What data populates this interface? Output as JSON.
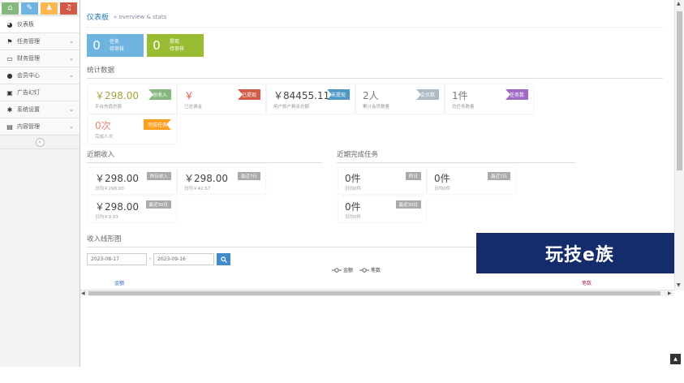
{
  "shortcuts": [
    {
      "icon": "home-icon",
      "glyph": "⌂",
      "color": "#87b87f"
    },
    {
      "icon": "pencil-icon",
      "glyph": "✎",
      "color": "#6fb3e0"
    },
    {
      "icon": "users-icon",
      "glyph": "♟",
      "color": "#ffb752"
    },
    {
      "icon": "bell-icon",
      "glyph": "♫",
      "color": "#d15b47"
    }
  ],
  "sidebar": {
    "items": [
      {
        "label": "仪表板",
        "icon": "dashboard-icon",
        "glyph": "◕",
        "chev": false
      },
      {
        "label": "任务管理",
        "icon": "flag-icon",
        "glyph": "⚑",
        "chev": true
      },
      {
        "label": "财务管理",
        "icon": "inbox-icon",
        "glyph": "▭",
        "chev": true
      },
      {
        "label": "会员中心",
        "icon": "user-icon",
        "glyph": "●",
        "chev": true
      },
      {
        "label": "广告幻灯",
        "icon": "picture-icon",
        "glyph": "▣",
        "chev": false
      },
      {
        "label": "系统设置",
        "icon": "gear-icon",
        "glyph": "✱",
        "chev": true
      },
      {
        "label": "内容管理",
        "icon": "book-icon",
        "glyph": "▤",
        "chev": true
      }
    ]
  },
  "header": {
    "title": "仪表板",
    "subtitle": "» overview & stats"
  },
  "tiles": [
    {
      "value": "0",
      "line1": "任务",
      "line2": "待审核",
      "color": "#6fb3e0"
    },
    {
      "value": "0",
      "line1": "提现",
      "line2": "待审核",
      "color": "#9abc32"
    }
  ],
  "stats_title": "统计数据",
  "stats": [
    {
      "value": "￥298.00",
      "caption": "平台充值总额",
      "badge": "总收入",
      "badge_color": "#87b87f",
      "value_color": "#a8a23d"
    },
    {
      "value": "￥",
      "caption": "已总佣金",
      "badge": "已提现",
      "badge_color": "#d15b47",
      "value_color": "#d15b47"
    },
    {
      "value": "￥84455.11",
      "caption": "用户账户剩余总额",
      "badge": "未提现",
      "badge_color": "#4f99c6",
      "value_color": "#444"
    },
    {
      "value": "2人",
      "caption": "累计会员数量",
      "badge": "会员数",
      "badge_color": "#abbac3",
      "value_color": "#777"
    },
    {
      "value": "1件",
      "caption": "总任务数量",
      "badge": "任务数",
      "badge_color": "#a069c3",
      "value_color": "#777"
    },
    {
      "value": "0次",
      "caption": "完成人次",
      "badge": "完成任务",
      "badge_color": "#ff9e1e",
      "value_color": "#e4877a"
    }
  ],
  "recent_income": {
    "title": "近期收入",
    "cards": [
      {
        "value": "￥298.00",
        "caption": "日均￥298.00",
        "badge": "昨日收入"
      },
      {
        "value": "￥298.00",
        "caption": "日均￥42.57",
        "badge": "最近7日"
      },
      {
        "value": "￥298.00",
        "caption": "日均￥9.93",
        "badge": "最近30日"
      }
    ]
  },
  "recent_tasks": {
    "title": "近期完成任务",
    "cards": [
      {
        "value": "0件",
        "caption": "日均0件",
        "badge": "昨日"
      },
      {
        "value": "0件",
        "caption": "日均0件",
        "badge": "最近7日"
      },
      {
        "value": "0件",
        "caption": "日均0件",
        "badge": "最近30日"
      }
    ]
  },
  "chart_section": {
    "title": "收入线形图",
    "date_from": "2023-08-17",
    "separator": "-",
    "date_to": "2023-09-16",
    "search_icon": "search-icon"
  },
  "chart_data": {
    "type": "line",
    "title": "",
    "series": [
      {
        "name": "金额",
        "color": "#2f64c8",
        "values": []
      },
      {
        "name": "笔数",
        "color": "#b22a52",
        "values": []
      }
    ],
    "ylabel_left": "金额",
    "ylabel_right": "笔数",
    "grid": false,
    "legend": "top-center"
  },
  "watermark": "玩技e族"
}
